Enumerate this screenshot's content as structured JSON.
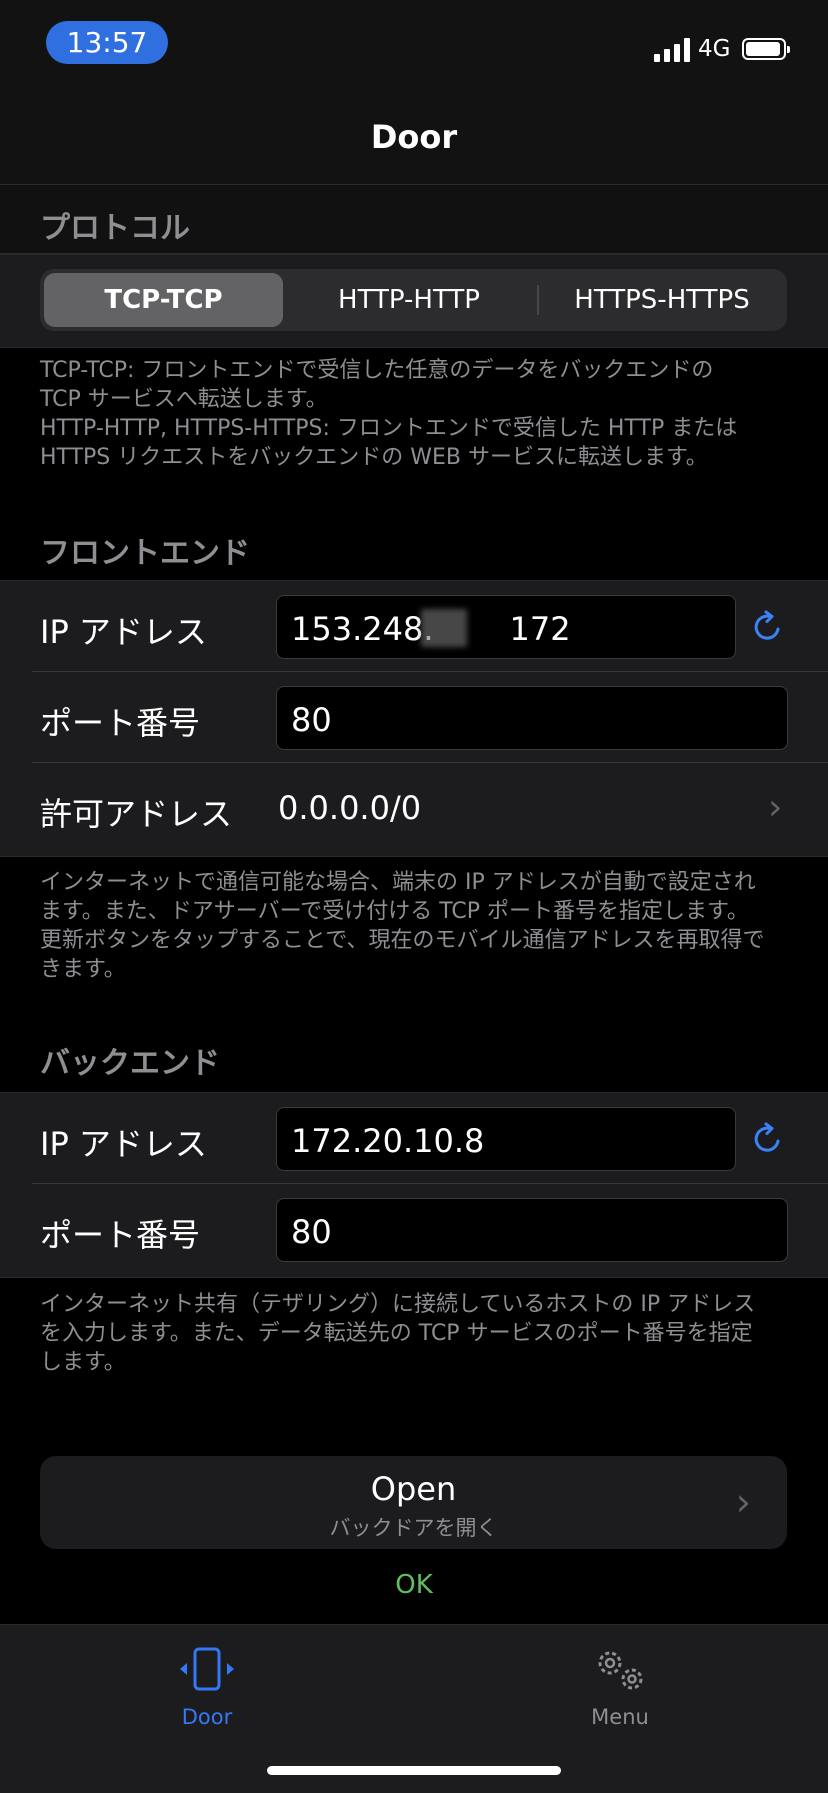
{
  "status_bar": {
    "time": "13:57",
    "network": "4G"
  },
  "nav": {
    "title": "Door"
  },
  "protocol": {
    "header": "プロトコル",
    "segments": [
      "TCP-TCP",
      "HTTP-HTTP",
      "HTTPS-HTTPS"
    ],
    "selected": "TCP-TCP",
    "note_lines": [
      "TCP-TCP: フロントエンドで受信した任意のデータをバックエンドの",
      "TCP サービスへ転送します。",
      "HTTP-HTTP, HTTPS-HTTPS: フロントエンドで受信した HTTP または",
      "HTTPS リクエストをバックエンドの WEB サービスに転送します。"
    ]
  },
  "frontend": {
    "header": "フロントエンド",
    "ip_label": "IP アドレス",
    "ip_value_start": "153.248.",
    "ip_value_end": "172",
    "port_label": "ポート番号",
    "port_value": "80",
    "allowed_label": "許可アドレス",
    "allowed_value": "0.0.0.0/0",
    "note_lines": [
      "インターネットで通信可能な場合、端末の IP アドレスが自動で設定され",
      "ます。また、ドアサーバーで受け付ける TCP ポート番号を指定します。",
      "更新ボタンをタップすることで、現在のモバイル通信アドレスを再取得で",
      "きます。"
    ]
  },
  "backend": {
    "header": "バックエンド",
    "ip_label": "IP アドレス",
    "ip_value": "172.20.10.8",
    "port_label": "ポート番号",
    "port_value": "80",
    "note_lines": [
      "インターネット共有（テザリング）に接続しているホストの IP アドレス",
      "を入力します。また、データ転送先の TCP サービスのポート番号を指定",
      "します。"
    ]
  },
  "open_button": {
    "label": "Open",
    "sublabel": "バックドアを開く"
  },
  "status_message": "OK",
  "tabs": [
    {
      "label": "Door",
      "icon": "door-phone-icon",
      "active": true
    },
    {
      "label": "Menu",
      "icon": "gears-icon",
      "active": false
    }
  ],
  "colors": {
    "accent": "#3a82f6",
    "ok": "#5fbf5f",
    "active_tab": "#3478f6",
    "inactive_tab": "#8e8e93"
  }
}
